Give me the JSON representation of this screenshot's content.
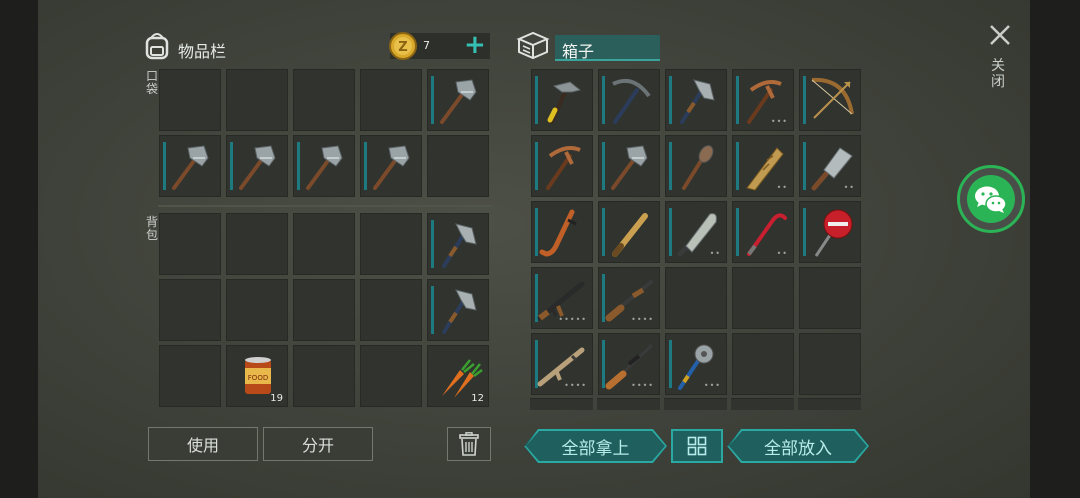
{
  "inventory": {
    "title": "物品栏",
    "coin_count": "7",
    "plus_label": "+"
  },
  "box": {
    "title": "箱子"
  },
  "sections": {
    "pocket": "口袋",
    "backpack": "背包"
  },
  "pocket_slots": [
    "",
    "",
    "",
    "",
    "hammer",
    "hammer",
    "hammer",
    "hammer",
    "hammer",
    ""
  ],
  "backpack_slots": [
    "",
    "",
    "",
    "",
    "hatchet",
    "",
    "",
    "",
    "",
    "hatchet",
    "",
    "canned_food",
    "",
    "",
    "carrot"
  ],
  "item_counts": {
    "canned_food": "19",
    "carrot": "12"
  },
  "box_slots": [
    {
      "item": "claw-hammer"
    },
    {
      "item": "pickaxe"
    },
    {
      "item": "hatchet"
    },
    {
      "item": "pickaxe-copper",
      "dots": "•••"
    },
    {
      "item": "bow"
    },
    {
      "item": "pickaxe-copper"
    },
    {
      "item": "hammer"
    },
    {
      "item": "mace"
    },
    {
      "item": "plank-club",
      "dots": "••"
    },
    {
      "item": "cleaver",
      "dots": "••"
    },
    {
      "item": "hockey-stick"
    },
    {
      "item": "baseball-bat"
    },
    {
      "item": "machete",
      "dots": "••"
    },
    {
      "item": "crowbar",
      "dots": "••"
    },
    {
      "item": "stop-sign"
    },
    {
      "item": "assault-rifle",
      "dots": "•••••"
    },
    {
      "item": "shotgun",
      "dots": "••••"
    },
    {
      "item": ""
    },
    {
      "item": ""
    },
    {
      "item": ""
    },
    {
      "item": "scar-rifle",
      "dots": "••••"
    },
    {
      "item": "hunting-rifle",
      "dots": "••••"
    },
    {
      "item": "saw-mace",
      "dots": "•••"
    },
    {
      "item": ""
    },
    {
      "item": ""
    }
  ],
  "buttons": {
    "use": "使用",
    "split": "分开",
    "take_all": "全部拿上",
    "put_all": "全部放入"
  },
  "close_label": "关闭",
  "colors": {
    "teal": "#2aa8a2",
    "wechat": "#2bb456",
    "durability": "#1c7a80"
  }
}
